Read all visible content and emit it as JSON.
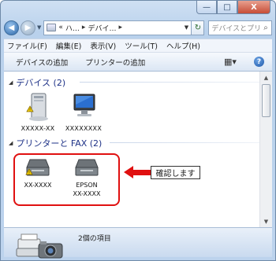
{
  "window": {
    "caption_buttons": {
      "minimize": "—",
      "maximize": "□",
      "close": "X"
    },
    "nav": {
      "back": "◀",
      "forward": "▶",
      "dropdown": "▼"
    },
    "address": {
      "prefix": "«",
      "crumbs": [
        "ハ…",
        "デバイ…"
      ],
      "separator": "▸",
      "dropdown": "▼",
      "refresh": "↻"
    },
    "search": {
      "placeholder": "デバイスとプリン…",
      "icon": "⌕"
    }
  },
  "menu": [
    "ファイル(F)",
    "編集(E)",
    "表示(V)",
    "ツール(T)",
    "ヘルプ(H)"
  ],
  "commands": {
    "add_device": "デバイスの追加",
    "add_printer": "プリンターの追加",
    "view_icon": "▦▾",
    "help_icon": "?"
  },
  "groups": {
    "devices": {
      "header": "デバイス (2)",
      "expander": "◢",
      "items": [
        {
          "label": "XXXXX-XX"
        },
        {
          "label": "XXXXXXXX"
        }
      ]
    },
    "printers": {
      "header": "プリンターと FAX (2)",
      "expander": "◢",
      "items": [
        {
          "label": "XX-XXXX"
        },
        {
          "label_line1": "EPSON",
          "label_line2": "XX-XXXX"
        }
      ]
    }
  },
  "callout": {
    "text": "確認します"
  },
  "scrollbar": {
    "up": "▲",
    "down": "▼"
  },
  "status": {
    "item_count": "2個の項目"
  },
  "colors": {
    "highlight": "#e01010",
    "group_header": "#1e3287"
  }
}
